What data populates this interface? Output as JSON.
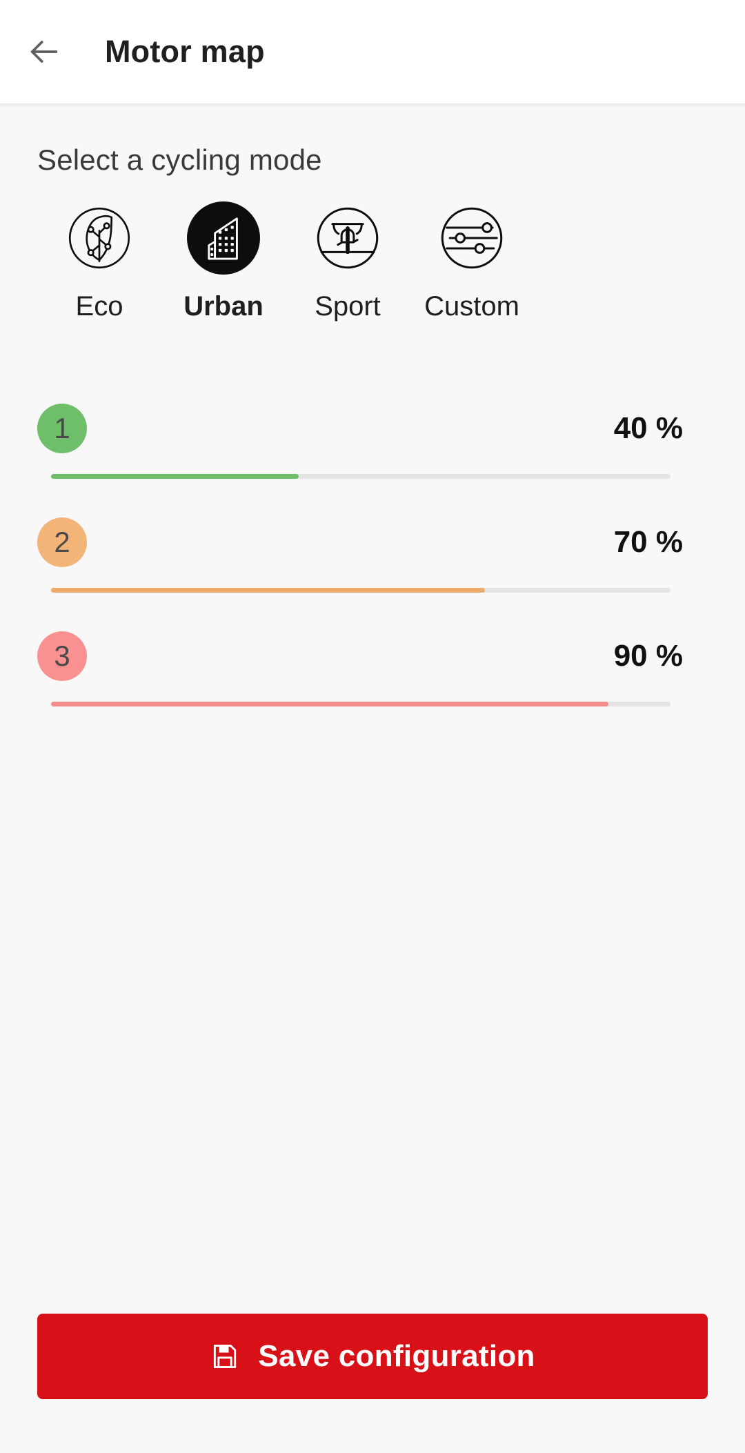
{
  "header": {
    "back_icon": "arrow-left-icon",
    "title": "Motor map"
  },
  "main": {
    "section_title": "Select a cycling mode",
    "modes": [
      {
        "label": "Eco",
        "icon": "leaf-circle-icon",
        "selected": false
      },
      {
        "label": "Urban",
        "icon": "building-circle-icon",
        "selected": true
      },
      {
        "label": "Sport",
        "icon": "bike-circle-icon",
        "selected": false
      },
      {
        "label": "Custom",
        "icon": "sliders-circle-icon",
        "selected": false
      }
    ],
    "levels": [
      {
        "number": "1",
        "value": "40 %",
        "percent": 40,
        "color": "#6EBE6A",
        "badge_color": "#6EBE6A"
      },
      {
        "number": "2",
        "value": "70 %",
        "percent": 70,
        "color": "#EFAB6B",
        "badge_color": "#F3B478"
      },
      {
        "number": "3",
        "value": "90 %",
        "percent": 90,
        "color": "#F48C8C",
        "badge_color": "#FA9191"
      }
    ]
  },
  "footer": {
    "save_label": "Save configuration",
    "save_icon": "floppy-disk-icon",
    "save_color": "#D81118"
  },
  "theme": {
    "background": "#f8f8f8",
    "appbar_background": "#ffffff",
    "track_color": "#e4e4e4",
    "text_primary": "#1f1f1f"
  }
}
